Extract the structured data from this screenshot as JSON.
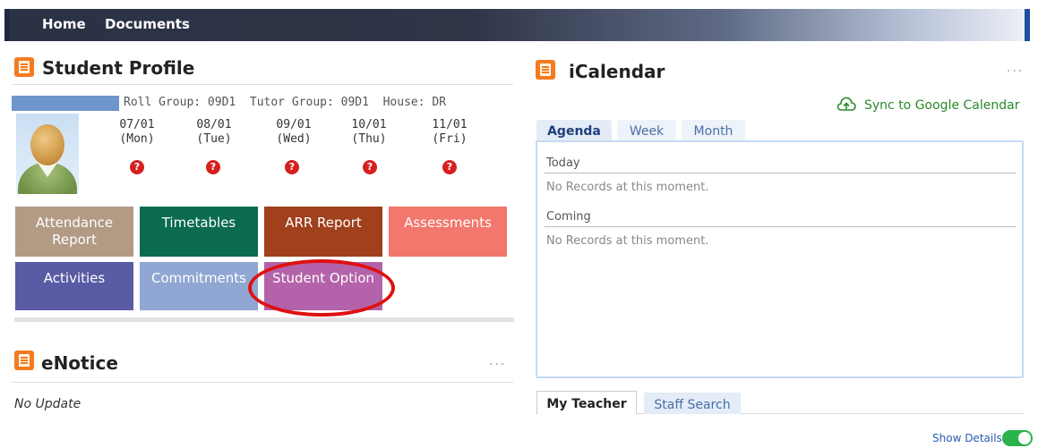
{
  "nav": {
    "home": "Home",
    "documents": "Documents"
  },
  "profile": {
    "title": "Student Profile",
    "info": "Roll Group: 09D1  Tutor Group: 09D1  House: DR",
    "days": [
      {
        "date": "07/01",
        "weekday": "(Mon)",
        "status": "?"
      },
      {
        "date": "08/01",
        "weekday": "(Tue)",
        "status": "?"
      },
      {
        "date": "09/01",
        "weekday": "(Wed)",
        "status": "?"
      },
      {
        "date": "10/01",
        "weekday": "(Thu)",
        "status": "?"
      },
      {
        "date": "11/01",
        "weekday": "(Fri)",
        "status": "?"
      }
    ],
    "tiles": [
      {
        "label": "Attendance Report",
        "color": "#b29a85"
      },
      {
        "label": "Timetables",
        "color": "#0a6b4f"
      },
      {
        "label": "ARR Report",
        "color": "#a0401c"
      },
      {
        "label": "Assessments",
        "color": "#f2776c"
      },
      {
        "label": "Activities",
        "color": "#5a5ba5"
      },
      {
        "label": "Commitments",
        "color": "#8fa7d2"
      },
      {
        "label": "Student Option",
        "color": "#b462a9"
      }
    ]
  },
  "enotice": {
    "title": "eNotice",
    "message": "No Update",
    "menu": "···"
  },
  "calendar": {
    "title": "iCalendar",
    "menu": "···",
    "sync_label": "Sync to Google Calendar",
    "tabs": [
      "Agenda",
      "Week",
      "Month"
    ],
    "sections": [
      {
        "label": "Today",
        "empty": "No Records at this moment."
      },
      {
        "label": "Coming",
        "empty": "No Records at this moment."
      }
    ]
  },
  "bottom_tabs": [
    "My Teacher",
    "Staff Search"
  ],
  "show_details": "Show Details",
  "colors": {
    "accent_orange": "#f47b20",
    "tab_blue": "#e3ecf7",
    "link_blue": "#2a5db0",
    "sync_green": "#2a8a2a"
  }
}
